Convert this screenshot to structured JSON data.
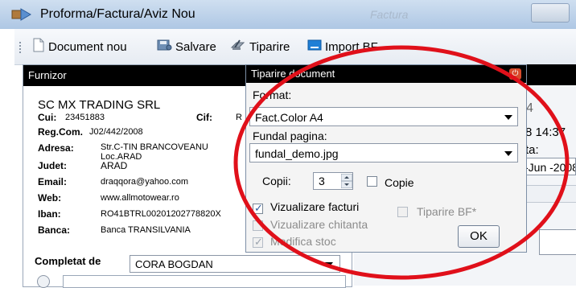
{
  "window": {
    "title": "Proforma/Factura/Aviz Nou",
    "bg_window_title": "Factura"
  },
  "toolbar": {
    "document_nou": "Document nou",
    "salvare": "Salvare",
    "tiparire": "Tiparire",
    "import_bf": "Import BF"
  },
  "furnizor": {
    "header": "Furnizor",
    "company": "SC MX TRADING SRL",
    "cui_label": "Cui:",
    "cui_value": "23451883",
    "cif_label": "Cif:",
    "cif_value": "R",
    "regcom_label": "Reg.Com.",
    "regcom_value": "J02/442/2008",
    "adresa_label": "Adresa:",
    "adresa_line1": "Str.C-TIN BRANCOVEANU",
    "adresa_line2": "Loc.ARAD",
    "judet_label": "Judet:",
    "judet_value": "ARAD",
    "email_label": "Email:",
    "email_value": "draqqora@yahoo.com",
    "web_label": "Web:",
    "web_value": "www.allmotowear.ro",
    "iban_label": "Iban:",
    "iban_value": "RO41BTRL00201202778820X",
    "banca_label": "Banca:",
    "banca_value": "Banca TRANSILVANIA",
    "completat_label": "Completat de",
    "completat_value": "CORA BOGDAN"
  },
  "right_panel": {
    "number": "4",
    "datetime": "8 14:37",
    "ta_label": "ta:",
    "date": "-Jun -2008"
  },
  "dialog": {
    "title": "Tiparire document",
    "format_label": "Format:",
    "format_value": "Fact.Color A4",
    "fundal_label": "Fundal pagina:",
    "fundal_value": "fundal_demo.jpg",
    "copii_label": "Copii:",
    "copii_value": "3",
    "copie_label": "Copie",
    "vizualizare_facturi": "Vizualizare facturi",
    "tiparire_bf": "Tiparire BF*",
    "vizualizare_chitanta": "Vizualizare chitanta",
    "modifica_stoc": "Modifica stoc",
    "ok": "OK",
    "checks": {
      "copie": false,
      "vizualizare_facturi": true,
      "tiparire_bf": false,
      "vizualizare_chitanta": false,
      "modifica_stoc": true
    }
  },
  "colors": {
    "annotation": "#e0101a",
    "header_bg": "#000000"
  }
}
